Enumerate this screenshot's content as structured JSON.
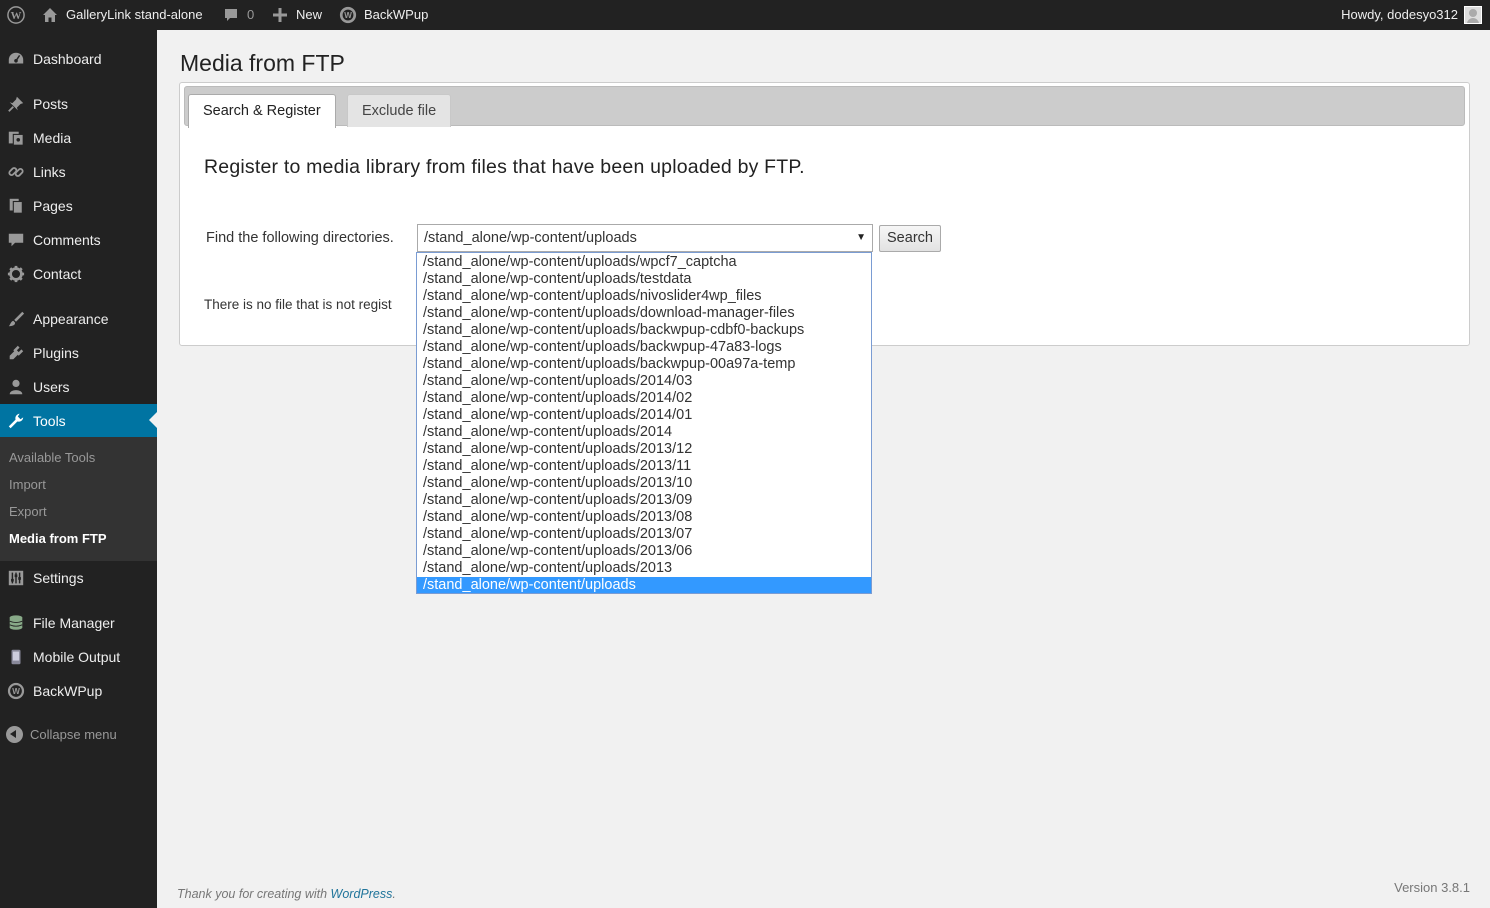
{
  "adminbar": {
    "site_name": "GalleryLink stand-alone",
    "comments_count": "0",
    "new_label": "New",
    "plugin_label": "BackWPup",
    "howdy": "Howdy, dodesyo312"
  },
  "sidebar": {
    "items": [
      {
        "label": "Dashboard",
        "icon": "dashboard-icon"
      },
      {
        "label": "Posts",
        "icon": "pin-icon"
      },
      {
        "label": "Media",
        "icon": "media-icon"
      },
      {
        "label": "Links",
        "icon": "link-icon"
      },
      {
        "label": "Pages",
        "icon": "pages-icon"
      },
      {
        "label": "Comments",
        "icon": "comment-icon"
      },
      {
        "label": "Contact",
        "icon": "gear-icon"
      },
      {
        "label": "Appearance",
        "icon": "brush-icon"
      },
      {
        "label": "Plugins",
        "icon": "plug-icon"
      },
      {
        "label": "Users",
        "icon": "user-icon"
      },
      {
        "label": "Tools",
        "icon": "wrench-icon"
      },
      {
        "label": "Settings",
        "icon": "settings-icon"
      },
      {
        "label": "File Manager",
        "icon": "database-icon"
      },
      {
        "label": "Mobile Output",
        "icon": "phone-icon"
      },
      {
        "label": "BackWPup",
        "icon": "wordpress-icon"
      }
    ],
    "submenu": [
      "Available Tools",
      "Import",
      "Export",
      "Media from FTP"
    ],
    "collapse_label": "Collapse menu"
  },
  "main": {
    "title": "Media from FTP",
    "tabs": [
      "Search & Register",
      "Exclude file"
    ],
    "intro": "Register to media library from files that have been uploaded by FTP.",
    "find_label": "Find the following directories.",
    "selected_dir": "/stand_alone/wp-content/uploads",
    "search_button": "Search",
    "no_file_message": "There is no file that is not regist"
  },
  "dropdown": {
    "options": [
      "/stand_alone/wp-content/uploads/wpcf7_captcha",
      "/stand_alone/wp-content/uploads/testdata",
      "/stand_alone/wp-content/uploads/nivoslider4wp_files",
      "/stand_alone/wp-content/uploads/download-manager-files",
      "/stand_alone/wp-content/uploads/backwpup-cdbf0-backups",
      "/stand_alone/wp-content/uploads/backwpup-47a83-logs",
      "/stand_alone/wp-content/uploads/backwpup-00a97a-temp",
      "/stand_alone/wp-content/uploads/2014/03",
      "/stand_alone/wp-content/uploads/2014/02",
      "/stand_alone/wp-content/uploads/2014/01",
      "/stand_alone/wp-content/uploads/2014",
      "/stand_alone/wp-content/uploads/2013/12",
      "/stand_alone/wp-content/uploads/2013/11",
      "/stand_alone/wp-content/uploads/2013/10",
      "/stand_alone/wp-content/uploads/2013/09",
      "/stand_alone/wp-content/uploads/2013/08",
      "/stand_alone/wp-content/uploads/2013/07",
      "/stand_alone/wp-content/uploads/2013/06",
      "/stand_alone/wp-content/uploads/2013",
      "/stand_alone/wp-content/uploads"
    ]
  },
  "footer": {
    "thanks_prefix": "Thank you for creating with ",
    "wordpress_link": "WordPress",
    "thanks_suffix": ".",
    "version": "Version 3.8.1"
  },
  "colors": {
    "adminbar_bg": "#222222",
    "menu_current": "#0074a2",
    "selected_option": "#3399ff",
    "link": "#21759b"
  }
}
